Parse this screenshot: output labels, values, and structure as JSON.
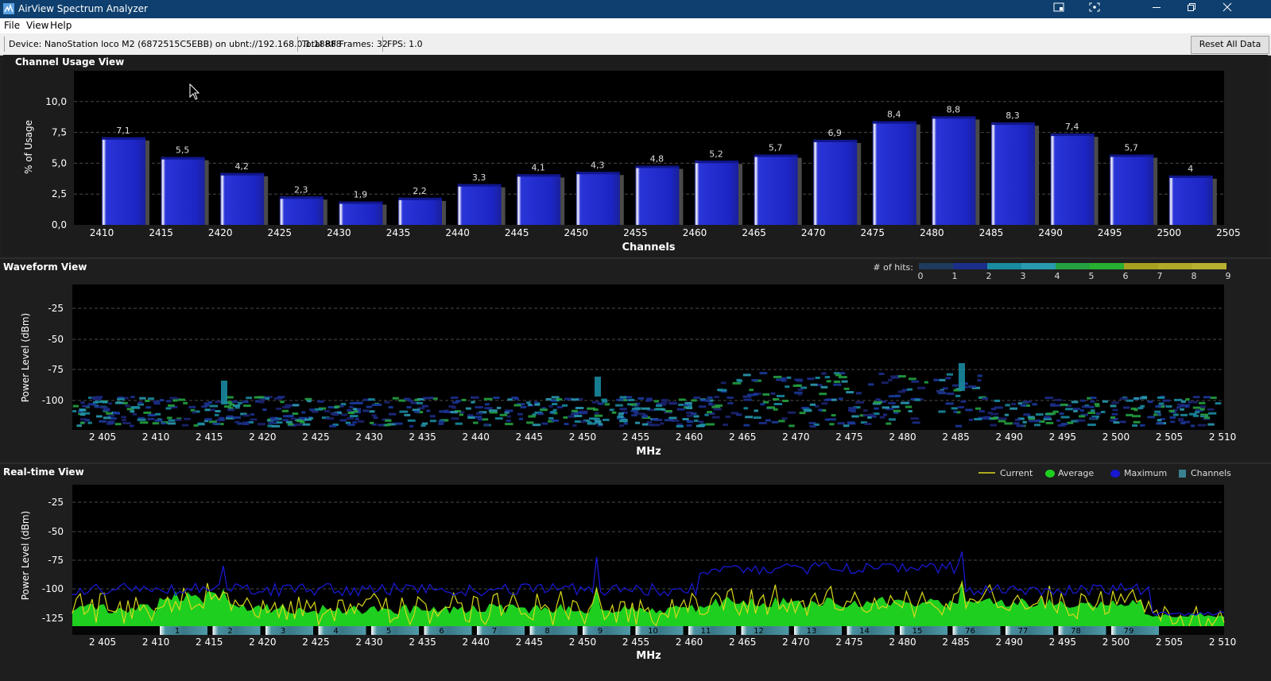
{
  "window": {
    "title": "AirView Spectrum Analyzer"
  },
  "menu": [
    "File",
    "View",
    "Help"
  ],
  "infobar": {
    "device": "Device: NanoStation loco M2 (6872515C5EBB) on ubnt://192.168.0.1:18888",
    "frames": "Total RF Frames: 32",
    "fps": "FPS: 1.0",
    "reset_label": "Reset All Data"
  },
  "colors": {
    "bar": "#1c25c4",
    "current": "#d8d81c",
    "average": "#1fcf1f",
    "maximum": "#1818d0",
    "channels": "#3a8090",
    "background": "#000000"
  },
  "channel_usage": {
    "title": "Channel Usage View",
    "chart_data": {
      "type": "bar",
      "ylabel": "% of Usage",
      "xlabel": "Channels",
      "ylim": [
        0,
        12.5
      ],
      "yticks": [
        "0,0",
        "2,5",
        "5,0",
        "7,5",
        "10,0"
      ],
      "xticks": [
        "2410",
        "2415",
        "2420",
        "2425",
        "2430",
        "2435",
        "2440",
        "2445",
        "2450",
        "2455",
        "2460",
        "2465",
        "2470",
        "2475",
        "2480",
        "2485",
        "2490",
        "2495",
        "2500",
        "2505"
      ],
      "values": [
        7.1,
        5.5,
        4.2,
        2.3,
        1.9,
        2.2,
        3.3,
        4.1,
        4.3,
        4.8,
        5.2,
        5.7,
        6.9,
        8.4,
        8.8,
        8.3,
        7.4,
        5.7,
        4
      ],
      "labels": [
        "7,1",
        "5,5",
        "4,2",
        "2,3",
        "1,9",
        "2,2",
        "3,3",
        "4,1",
        "4,3",
        "4,8",
        "5,2",
        "5,7",
        "6,9",
        "8,4",
        "8,8",
        "8,3",
        "7,4",
        "5,7",
        "4"
      ]
    }
  },
  "waveform": {
    "title": "Waveform View",
    "hits_label": "# of hits:",
    "hits_scale": [
      "0",
      "1",
      "2",
      "3",
      "4",
      "5",
      "6",
      "7",
      "8",
      "9"
    ],
    "ylabel": "Power Level (dBm)",
    "yticks": [
      "-25",
      "-50",
      "-75",
      "-100"
    ],
    "xlabel": "MHz",
    "xticks": [
      "2 405",
      "2 410",
      "2 415",
      "2 420",
      "2 425",
      "2 430",
      "2 435",
      "2 440",
      "2 445",
      "2 450",
      "2 455",
      "2 460",
      "2 465",
      "2 470",
      "2 475",
      "2 480",
      "2 485",
      "2 490",
      "2 495",
      "2 500",
      "2 505",
      "2 510"
    ]
  },
  "realtime": {
    "title": "Real-time View",
    "legend": [
      "Current",
      "Average",
      "Maximum",
      "Channels"
    ],
    "ylabel": "Power Level (dBm)",
    "yticks": [
      "-25",
      "-50",
      "-75",
      "-100",
      "-125"
    ],
    "xlabel": "MHz",
    "xticks": [
      "2 405",
      "2 410",
      "2 415",
      "2 420",
      "2 425",
      "2 430",
      "2 435",
      "2 440",
      "2 445",
      "2 450",
      "2 455",
      "2 460",
      "2 465",
      "2 470",
      "2 475",
      "2 480",
      "2 485",
      "2 490",
      "2 495",
      "2 500",
      "2 505",
      "2 510"
    ],
    "channels": [
      "1",
      "2",
      "3",
      "4",
      "5",
      "6",
      "7",
      "8",
      "9",
      "10",
      "11",
      "12",
      "13",
      "14",
      "15",
      "76",
      "77",
      "78",
      "79"
    ]
  }
}
